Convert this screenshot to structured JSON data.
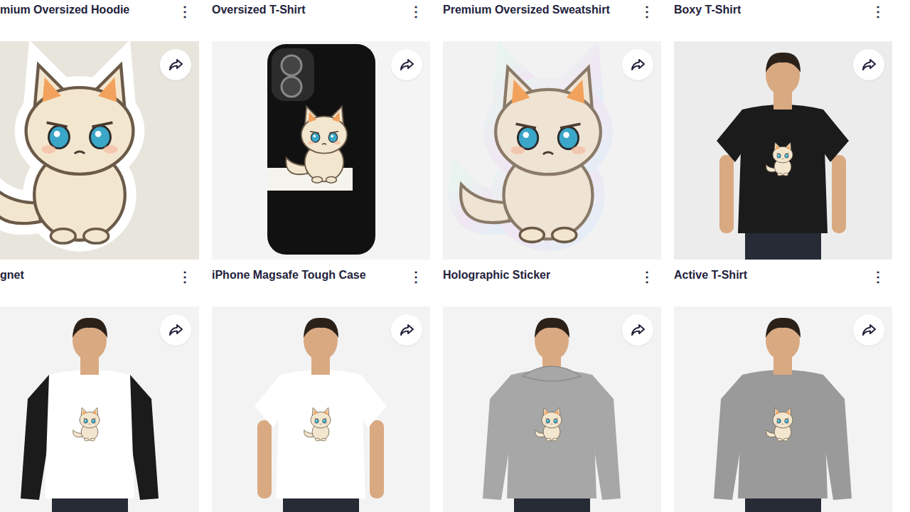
{
  "grid": {
    "rows": [
      {
        "cards": [
          {
            "title": "mium Oversized Hoodie",
            "menu": "⋮"
          },
          {
            "title": "Oversized T-Shirt",
            "menu": "⋮"
          },
          {
            "title": "Premium Oversized Sweatshirt",
            "menu": "⋮"
          },
          {
            "title": "Boxy T-Shirt",
            "menu": "⋮"
          }
        ]
      },
      {
        "cards": [
          {
            "image_kind": "sticker",
            "title": "gnet",
            "menu": "⋮"
          },
          {
            "image_kind": "phone-case",
            "title": "iPhone Magsafe Tough Case",
            "menu": "⋮"
          },
          {
            "image_kind": "holo-sticker",
            "title": "Holographic Sticker",
            "menu": "⋮"
          },
          {
            "image_kind": "tee-dark",
            "title": "Active T-Shirt",
            "menu": "⋮"
          }
        ]
      },
      {
        "cards": [
          {
            "image_kind": "raglan"
          },
          {
            "image_kind": "tee-white"
          },
          {
            "image_kind": "hoodie"
          },
          {
            "image_kind": "sweatshirt"
          }
        ]
      }
    ]
  }
}
